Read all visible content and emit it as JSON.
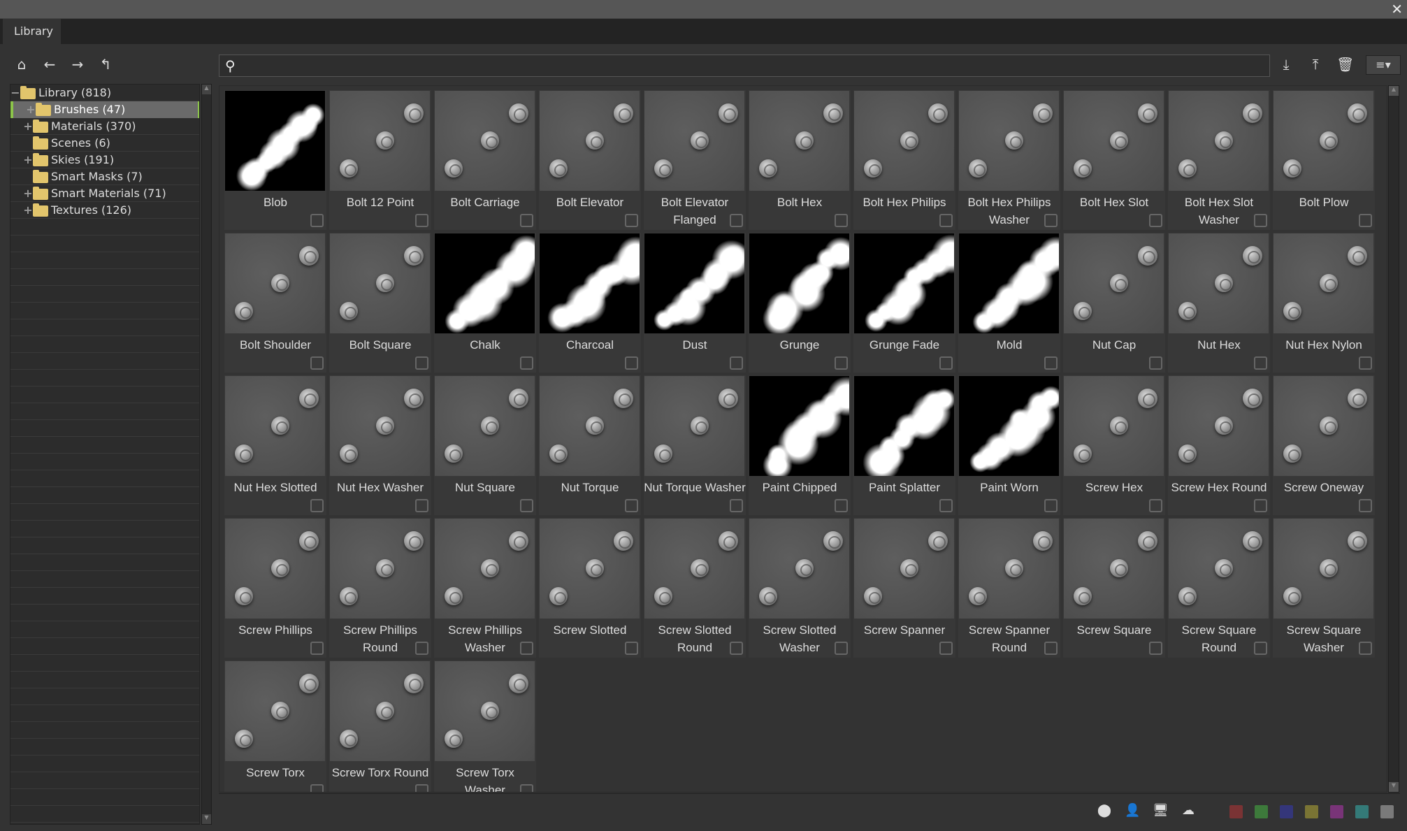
{
  "window": {
    "close_icon": "close-icon"
  },
  "tabs": [
    {
      "label": "Library"
    }
  ],
  "toolbar": {
    "nav_icons": [
      "home-icon",
      "back-arrow-icon",
      "forward-arrow-icon",
      "up-level-icon"
    ],
    "search_placeholder": "",
    "search_value": "",
    "actions": [
      "import-icon",
      "export-icon",
      "trash-icon",
      "view-menu-icon"
    ]
  },
  "tree": [
    {
      "label": "Library (818)",
      "expander": "−",
      "depth": 0
    },
    {
      "label": "Brushes (47)",
      "expander": "+",
      "depth": 1,
      "selected": true
    },
    {
      "label": "Materials (370)",
      "expander": "+",
      "depth": 1
    },
    {
      "label": "Scenes (6)",
      "expander": "",
      "depth": 1
    },
    {
      "label": "Skies (191)",
      "expander": "+",
      "depth": 1
    },
    {
      "label": "Smart Masks (7)",
      "expander": "",
      "depth": 1
    },
    {
      "label": "Smart Materials (71)",
      "expander": "+",
      "depth": 1
    },
    {
      "label": "Textures (126)",
      "expander": "+",
      "depth": 1
    }
  ],
  "items": [
    {
      "name": "Blob",
      "kind": "mask"
    },
    {
      "name": "Bolt 12 Point",
      "kind": "bolt"
    },
    {
      "name": "Bolt Carriage",
      "kind": "bolt"
    },
    {
      "name": "Bolt Elevator",
      "kind": "bolt"
    },
    {
      "name": "Bolt Elevator Flanged",
      "kind": "bolt"
    },
    {
      "name": "Bolt Hex",
      "kind": "bolt"
    },
    {
      "name": "Bolt Hex Philips",
      "kind": "bolt"
    },
    {
      "name": "Bolt Hex Philips Washer",
      "kind": "bolt"
    },
    {
      "name": "Bolt Hex Slot",
      "kind": "bolt"
    },
    {
      "name": "Bolt Hex Slot Washer",
      "kind": "bolt"
    },
    {
      "name": "Bolt Plow",
      "kind": "bolt"
    },
    {
      "name": "Bolt Shoulder",
      "kind": "bolt"
    },
    {
      "name": "Bolt Square",
      "kind": "bolt"
    },
    {
      "name": "Chalk",
      "kind": "mask"
    },
    {
      "name": "Charcoal",
      "kind": "mask"
    },
    {
      "name": "Dust",
      "kind": "mask"
    },
    {
      "name": "Grunge",
      "kind": "mask"
    },
    {
      "name": "Grunge Fade",
      "kind": "mask"
    },
    {
      "name": "Mold",
      "kind": "mask"
    },
    {
      "name": "Nut Cap",
      "kind": "bolt"
    },
    {
      "name": "Nut Hex",
      "kind": "bolt"
    },
    {
      "name": "Nut Hex Nylon",
      "kind": "bolt"
    },
    {
      "name": "Nut Hex Slotted",
      "kind": "bolt"
    },
    {
      "name": "Nut Hex Washer",
      "kind": "bolt"
    },
    {
      "name": "Nut Square",
      "kind": "bolt"
    },
    {
      "name": "Nut Torque",
      "kind": "bolt"
    },
    {
      "name": "Nut Torque Washer",
      "kind": "bolt"
    },
    {
      "name": "Paint Chipped",
      "kind": "mask"
    },
    {
      "name": "Paint Splatter",
      "kind": "mask"
    },
    {
      "name": "Paint Worn",
      "kind": "mask"
    },
    {
      "name": "Screw Hex",
      "kind": "bolt"
    },
    {
      "name": "Screw Hex Round",
      "kind": "bolt"
    },
    {
      "name": "Screw Oneway",
      "kind": "bolt"
    },
    {
      "name": "Screw Phillips",
      "kind": "bolt"
    },
    {
      "name": "Screw Phillips Round",
      "kind": "bolt"
    },
    {
      "name": "Screw Phillips Washer",
      "kind": "bolt"
    },
    {
      "name": "Screw Slotted",
      "kind": "bolt"
    },
    {
      "name": "Screw Slotted Round",
      "kind": "bolt"
    },
    {
      "name": "Screw Slotted Washer",
      "kind": "bolt"
    },
    {
      "name": "Screw Spanner",
      "kind": "bolt"
    },
    {
      "name": "Screw Spanner Round",
      "kind": "bolt"
    },
    {
      "name": "Screw Square",
      "kind": "bolt"
    },
    {
      "name": "Screw Square Round",
      "kind": "bolt"
    },
    {
      "name": "Screw Square Washer",
      "kind": "bolt"
    },
    {
      "name": "Screw Torx",
      "kind": "bolt"
    },
    {
      "name": "Screw Torx Round",
      "kind": "bolt"
    },
    {
      "name": "Screw Torx Washer",
      "kind": "bolt"
    }
  ],
  "footer": {
    "filter_icons": [
      "shader-icon",
      "user-icon",
      "computer-icon",
      "cloud-icon"
    ],
    "color_tags": [
      "#7a3334",
      "#3d7a3b",
      "#34367a",
      "#7a7434",
      "#793478",
      "#347a78",
      "#7a7a7a"
    ]
  }
}
